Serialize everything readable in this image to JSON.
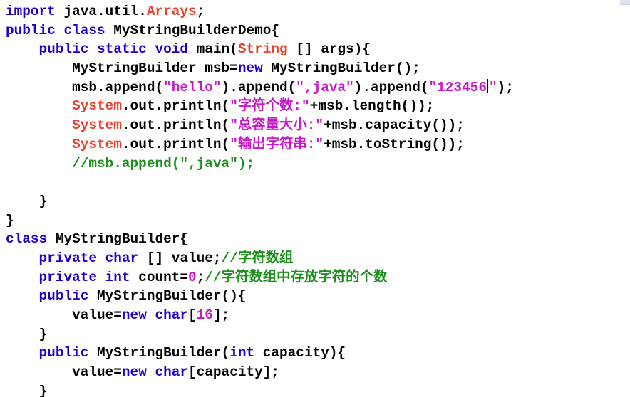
{
  "code_lines": [
    {
      "tokens": [
        {
          "t": "kw",
          "v": "import"
        },
        {
          "t": "plain",
          "v": " java.util."
        },
        {
          "t": "cls",
          "v": "Arrays"
        },
        {
          "t": "plain",
          "v": ";"
        }
      ]
    },
    {
      "tokens": [
        {
          "t": "kw",
          "v": "public class"
        },
        {
          "t": "plain",
          "v": " MyStringBuilderDemo{"
        }
      ]
    },
    {
      "tokens": [
        {
          "t": "plain",
          "v": "    "
        },
        {
          "t": "kw",
          "v": "public static void"
        },
        {
          "t": "plain",
          "v": " main("
        },
        {
          "t": "cls",
          "v": "String"
        },
        {
          "t": "plain",
          "v": " [] args){"
        }
      ]
    },
    {
      "tokens": [
        {
          "t": "plain",
          "v": "        MyStringBuilder msb="
        },
        {
          "t": "kw",
          "v": "new"
        },
        {
          "t": "plain",
          "v": " MyStringBuilder();"
        }
      ]
    },
    {
      "tokens": [
        {
          "t": "plain",
          "v": "        msb.append("
        },
        {
          "t": "str",
          "v": "\"hello\""
        },
        {
          "t": "plain",
          "v": ").append("
        },
        {
          "t": "str",
          "v": "\",java\""
        },
        {
          "t": "plain",
          "v": ").append("
        },
        {
          "t": "str",
          "v": "\"123456"
        },
        {
          "t": "caret",
          "v": ""
        },
        {
          "t": "str",
          "v": "\""
        },
        {
          "t": "plain",
          "v": ");"
        }
      ]
    },
    {
      "tokens": [
        {
          "t": "plain",
          "v": "        "
        },
        {
          "t": "cls",
          "v": "System"
        },
        {
          "t": "plain",
          "v": ".out.println("
        },
        {
          "t": "str",
          "v": "\"字符个数:\""
        },
        {
          "t": "plain",
          "v": "+msb.length());"
        }
      ]
    },
    {
      "tokens": [
        {
          "t": "plain",
          "v": "        "
        },
        {
          "t": "cls",
          "v": "System"
        },
        {
          "t": "plain",
          "v": ".out.println("
        },
        {
          "t": "str",
          "v": "\"总容量大小:\""
        },
        {
          "t": "plain",
          "v": "+msb.capacity());"
        }
      ]
    },
    {
      "tokens": [
        {
          "t": "plain",
          "v": "        "
        },
        {
          "t": "cls",
          "v": "System"
        },
        {
          "t": "plain",
          "v": ".out.println("
        },
        {
          "t": "str",
          "v": "\"输出字符串:\""
        },
        {
          "t": "plain",
          "v": "+msb.toString());"
        }
      ]
    },
    {
      "tokens": [
        {
          "t": "plain",
          "v": "        "
        },
        {
          "t": "cmt",
          "v": "//msb.append(\",java\");"
        }
      ]
    },
    {
      "tokens": [
        {
          "t": "plain",
          "v": ""
        }
      ]
    },
    {
      "tokens": [
        {
          "t": "plain",
          "v": "    }"
        }
      ]
    },
    {
      "tokens": [
        {
          "t": "plain",
          "v": "}"
        }
      ]
    },
    {
      "tokens": [
        {
          "t": "kw",
          "v": "class"
        },
        {
          "t": "plain",
          "v": " MyStringBuilder{"
        }
      ]
    },
    {
      "tokens": [
        {
          "t": "plain",
          "v": "    "
        },
        {
          "t": "kw",
          "v": "private char"
        },
        {
          "t": "plain",
          "v": " [] value;"
        },
        {
          "t": "cmt",
          "v": "//字符数组"
        }
      ]
    },
    {
      "tokens": [
        {
          "t": "plain",
          "v": "    "
        },
        {
          "t": "kw",
          "v": "private int"
        },
        {
          "t": "plain",
          "v": " count="
        },
        {
          "t": "num",
          "v": "0"
        },
        {
          "t": "plain",
          "v": ";"
        },
        {
          "t": "cmt",
          "v": "//字符数组中存放字符的个数"
        }
      ]
    },
    {
      "tokens": [
        {
          "t": "plain",
          "v": "    "
        },
        {
          "t": "kw",
          "v": "public"
        },
        {
          "t": "plain",
          "v": " MyStringBuilder(){"
        }
      ]
    },
    {
      "tokens": [
        {
          "t": "plain",
          "v": "        value="
        },
        {
          "t": "kw",
          "v": "new char"
        },
        {
          "t": "plain",
          "v": "["
        },
        {
          "t": "num",
          "v": "16"
        },
        {
          "t": "plain",
          "v": "];"
        }
      ]
    },
    {
      "tokens": [
        {
          "t": "plain",
          "v": "    }"
        }
      ]
    },
    {
      "tokens": [
        {
          "t": "plain",
          "v": "    "
        },
        {
          "t": "kw",
          "v": "public"
        },
        {
          "t": "plain",
          "v": " MyStringBuilder("
        },
        {
          "t": "kw",
          "v": "int"
        },
        {
          "t": "plain",
          "v": " capacity){"
        }
      ]
    },
    {
      "tokens": [
        {
          "t": "plain",
          "v": "        value="
        },
        {
          "t": "kw",
          "v": "new char"
        },
        {
          "t": "plain",
          "v": "[capacity];"
        }
      ]
    },
    {
      "tokens": [
        {
          "t": "plain",
          "v": "    }"
        }
      ]
    }
  ],
  "colors": {
    "keyword": "#1f00c8",
    "class_ref": "#e8402a",
    "string": "#c819c8",
    "comment": "#1a8f1a",
    "text": "#000000",
    "background": "#ffffff"
  }
}
